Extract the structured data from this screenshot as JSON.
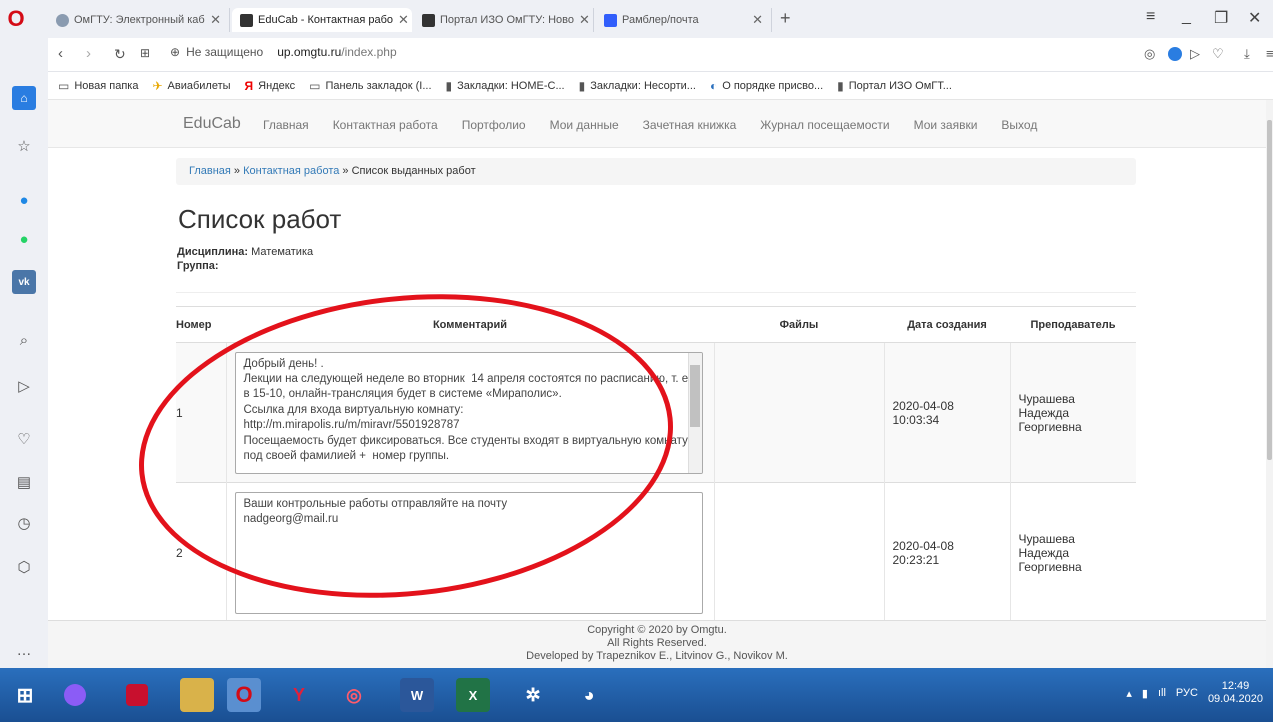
{
  "browser": {
    "tabs": [
      {
        "label": "ОмГТУ: Электронный каб",
        "active": false,
        "favicon_color": "#8a9bb0"
      },
      {
        "label": "EduCab - Контактная рабо",
        "active": true,
        "favicon_color": "#333333"
      },
      {
        "label": "Портал ИЗО ОмГТУ: Ново",
        "active": false,
        "favicon_color": "#333333"
      },
      {
        "label": "Рамблер/почта",
        "active": false,
        "favicon_color": "#315efb"
      }
    ],
    "new_tab": "+",
    "address": {
      "security": "Не защищено",
      "url_host": "up.omgtu.ru",
      "url_path": "/index.php"
    },
    "bookmarks": [
      {
        "label": "Новая папка",
        "icon": "folder-icon"
      },
      {
        "label": "Авиабилеты",
        "icon": "plane-icon"
      },
      {
        "label": "Яндекс",
        "icon": "yandex-icon"
      },
      {
        "label": "Панель закладок (I...",
        "icon": "folder-icon"
      },
      {
        "label": "Закладки: HOME-C...",
        "icon": "page-icon"
      },
      {
        "label": "Закладки: Несорти...",
        "icon": "page-icon"
      },
      {
        "label": "О порядке присво...",
        "icon": "link-icon"
      },
      {
        "label": "Портал ИЗО ОмГТ...",
        "icon": "page-icon"
      }
    ]
  },
  "site": {
    "brand": "EduCab",
    "nav": [
      "Главная",
      "Контактная работа",
      "Портфолио",
      "Мои данные",
      "Зачетная книжка",
      "Журнал посещаемости",
      "Мои заявки",
      "Выход"
    ],
    "breadcrumb": {
      "home": "Главная",
      "sep": " » ",
      "section": "Контактная работа",
      "current": "Список выданных работ"
    },
    "title": "Список работ",
    "discipline_label": "Дисциплина:",
    "discipline_value": "Математика",
    "group_label": "Группа:",
    "group_value": "",
    "table": {
      "headers": [
        "Номер",
        "Комментарий",
        "Файлы",
        "Дата создания",
        "Преподаватель"
      ],
      "rows": [
        {
          "num": "1",
          "comment": "Добрый день! .\nЛекции на следующей неделе во вторник  14 апреля состоятся по расписанию, т. е. в 15-10, онлайн-трансляция будет в системе «Мираполис».\nСсылка для входа виртуальную комнату:\nhttp://m.mirapolis.ru/m/miravr/5501928787\nПосещаемость будет фиксироваться. Все студенты входят в виртуальную комнату под своей фамилией +  номер группы.",
          "files": "",
          "date": "2020-04-08 10:03:34",
          "teacher": "Чурашева Надежда Георгиевна"
        },
        {
          "num": "2",
          "comment": "Ваши контрольные работы отправляйте на почту\nnadgeorg@mail.ru",
          "files": "",
          "date": "2020-04-08 20:23:21",
          "teacher": "Чурашева Надежда Георгиевна"
        }
      ]
    },
    "footer": [
      "Copyright © 2020 by Omgtu.",
      "All Rights Reserved.",
      "Developed by Trapeznikov E., Litvinov G., Novikov M."
    ]
  },
  "taskbar": {
    "lang": "РУС",
    "time": "12:49",
    "date": "09.04.2020"
  },
  "colors": {
    "accent": "#337ab7",
    "annotation": "#e3121b",
    "taskbar": "#1e5fa6"
  }
}
